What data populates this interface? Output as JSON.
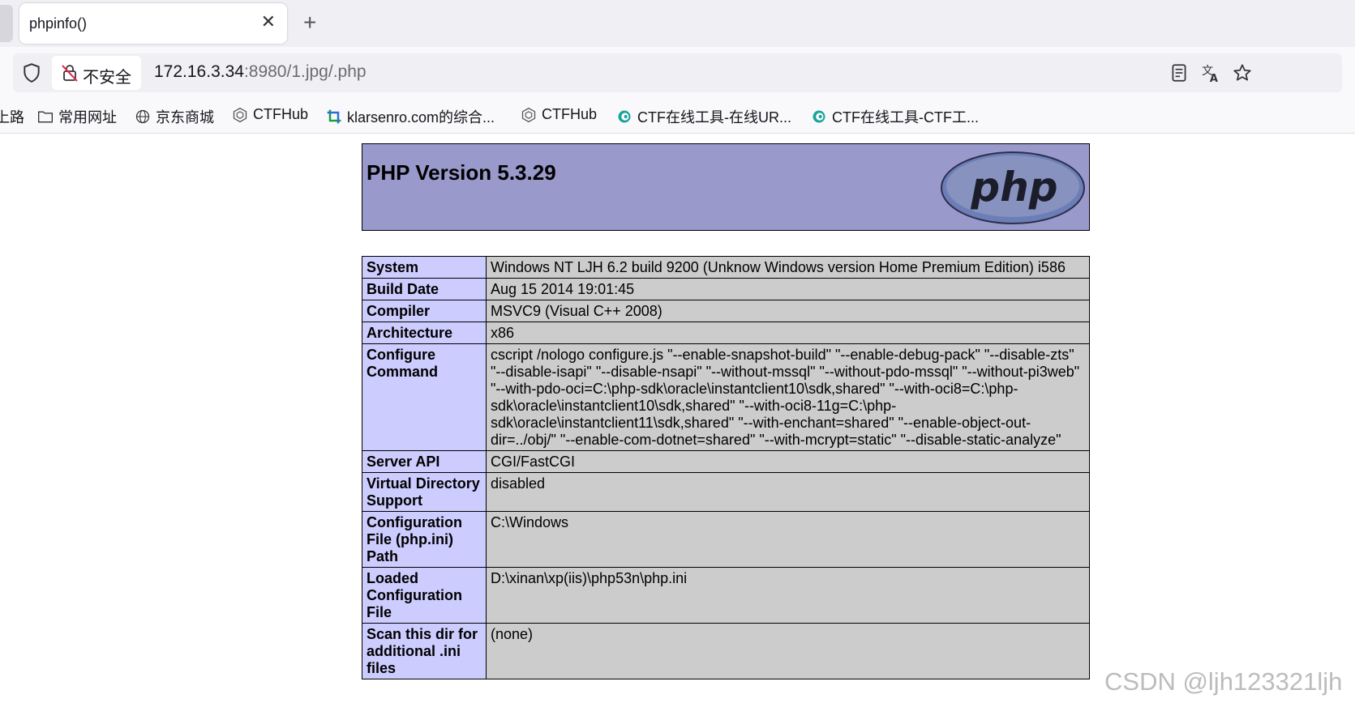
{
  "browser": {
    "tab_title": "phpinfo()",
    "tab_close": "✕",
    "new_tab": "+",
    "security_label": "不安全",
    "url_host": "172.16.3.34",
    "url_rest": ":8980/1.jpg/.php"
  },
  "bookmarks": [
    {
      "label": "上路",
      "icon": "truncated-icon"
    },
    {
      "label": "常用网址",
      "icon": "folder-icon"
    },
    {
      "label": "京东商城",
      "icon": "globe-icon"
    },
    {
      "label": "CTFHub",
      "icon": "ctfhub-icon"
    },
    {
      "label": "klarsenro.com的综合...",
      "icon": "site-icon"
    },
    {
      "label": "CTFHub",
      "icon": "ctfhub-icon"
    },
    {
      "label": "CTF在线工具-在线UR...",
      "icon": "ctf-tool-icon"
    },
    {
      "label": "CTF在线工具-CTF工...",
      "icon": "ctf-tool-icon"
    }
  ],
  "phpinfo": {
    "version_title": "PHP Version 5.3.29",
    "logo_text": "php",
    "rows": [
      {
        "key": "System",
        "value": "Windows NT LJH 6.2 build 9200 (Unknow Windows version Home Premium Edition) i586"
      },
      {
        "key": "Build Date",
        "value": "Aug 15 2014 19:01:45"
      },
      {
        "key": "Compiler",
        "value": "MSVC9 (Visual C++ 2008)"
      },
      {
        "key": "Architecture",
        "value": "x86"
      },
      {
        "key": "Configure Command",
        "value": "cscript /nologo configure.js \"--enable-snapshot-build\" \"--enable-debug-pack\" \"--disable-zts\" \"--disable-isapi\" \"--disable-nsapi\" \"--without-mssql\" \"--without-pdo-mssql\" \"--without-pi3web\" \"--with-pdo-oci=C:\\php-sdk\\oracle\\instantclient10\\sdk,shared\" \"--with-oci8=C:\\php-sdk\\oracle\\instantclient10\\sdk,shared\" \"--with-oci8-11g=C:\\php-sdk\\oracle\\instantclient11\\sdk,shared\" \"--with-enchant=shared\" \"--enable-object-out-dir=../obj/\" \"--enable-com-dotnet=shared\" \"--with-mcrypt=static\" \"--disable-static-analyze\""
      },
      {
        "key": "Server API",
        "value": "CGI/FastCGI"
      },
      {
        "key": "Virtual Directory Support",
        "value": "disabled"
      },
      {
        "key": "Configuration File (php.ini) Path",
        "value": "C:\\Windows"
      },
      {
        "key": "Loaded Configuration File",
        "value": "D:\\xinan\\xp(iis)\\php53n\\php.ini"
      },
      {
        "key": "Scan this dir for additional .ini files",
        "value": "(none)"
      }
    ]
  },
  "watermark": "CSDN @ljh123321ljh"
}
